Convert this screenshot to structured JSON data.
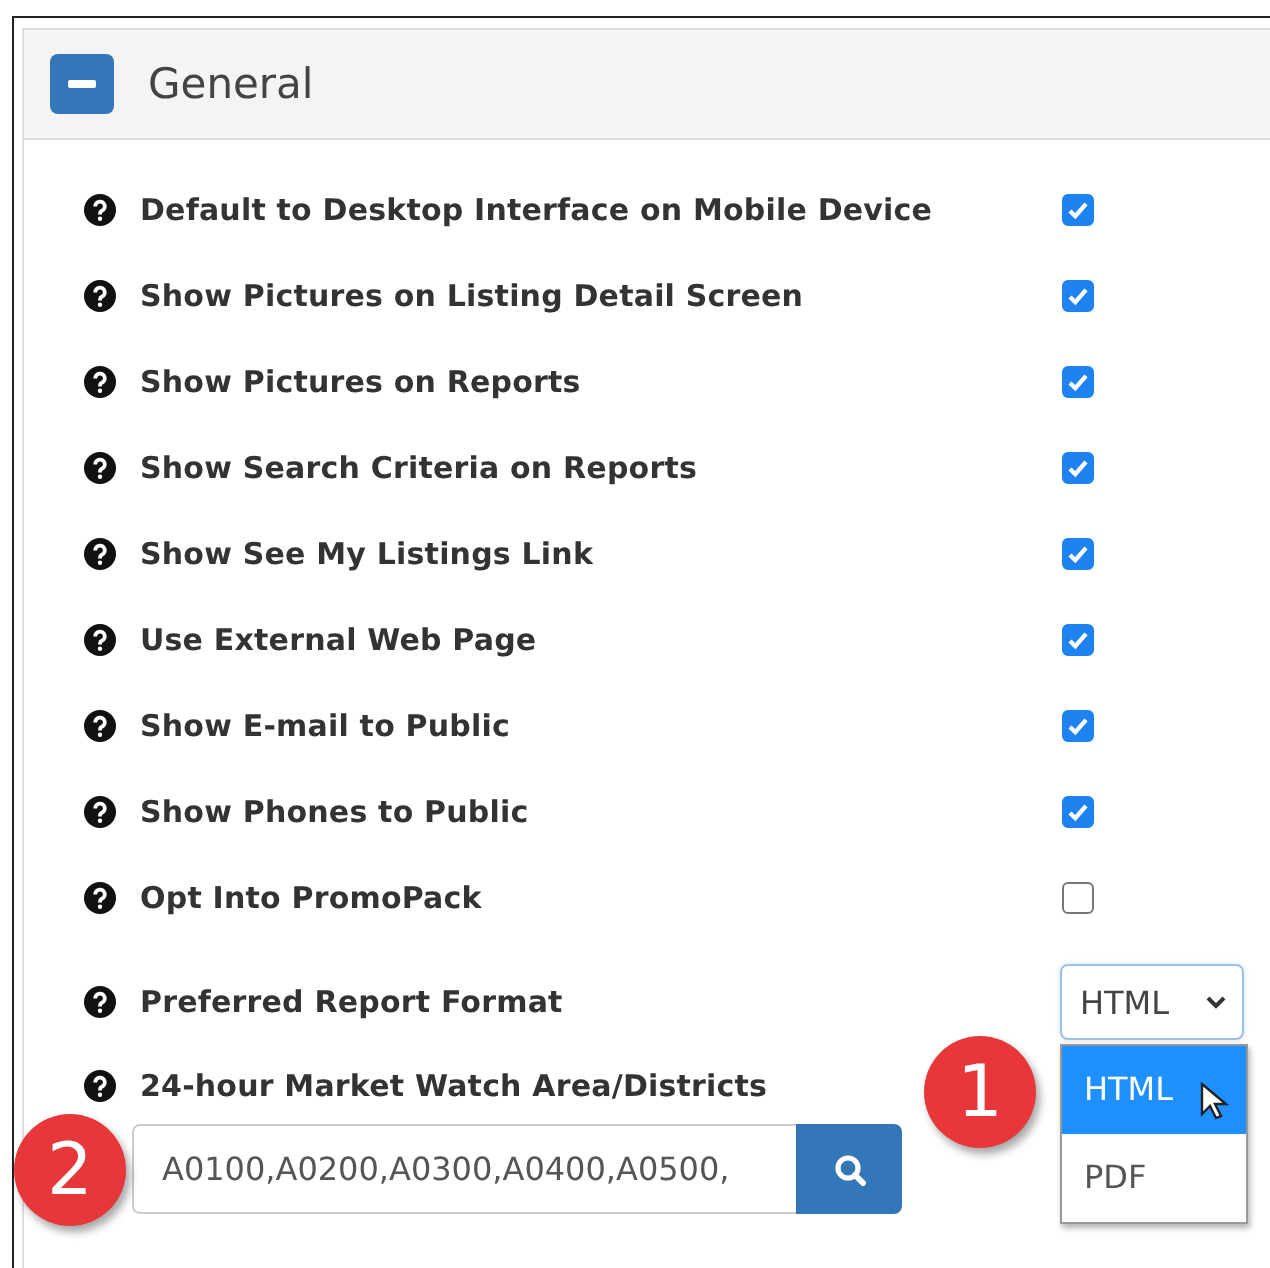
{
  "panel": {
    "title": "General",
    "expanded": true
  },
  "settings": [
    {
      "kind": "checkbox",
      "label": "Default to Desktop Interface on Mobile Device",
      "checked": true
    },
    {
      "kind": "checkbox",
      "label": "Show Pictures on Listing Detail Screen",
      "checked": true
    },
    {
      "kind": "checkbox",
      "label": "Show Pictures on Reports",
      "checked": true
    },
    {
      "kind": "checkbox",
      "label": "Show Search Criteria on Reports",
      "checked": true
    },
    {
      "kind": "checkbox",
      "label": "Show See My Listings Link",
      "checked": true
    },
    {
      "kind": "checkbox",
      "label": "Use External Web Page",
      "checked": true
    },
    {
      "kind": "checkbox",
      "label": "Show E-mail to Public",
      "checked": true
    },
    {
      "kind": "checkbox",
      "label": "Show Phones to Public",
      "checked": true
    },
    {
      "kind": "checkbox",
      "label": "Opt Into PromoPack",
      "checked": false
    },
    {
      "kind": "select",
      "label": "Preferred Report Format",
      "value": "HTML",
      "expanded": true,
      "callout": "1",
      "options": [
        {
          "label": "HTML",
          "selected": true
        },
        {
          "label": "PDF",
          "selected": false
        }
      ]
    },
    {
      "kind": "lookup",
      "label": "24-hour Market Watch Area/Districts",
      "value": "A0100,A0200,A0300,A0400,A0500,",
      "callout": "2"
    }
  ]
}
